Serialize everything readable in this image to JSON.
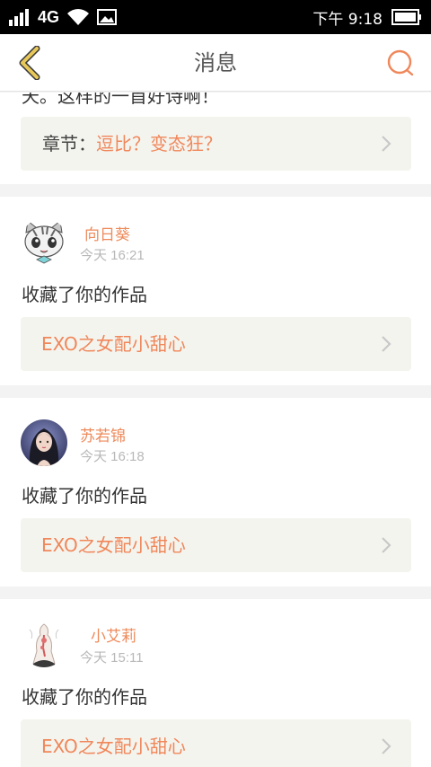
{
  "status_bar": {
    "network": "4G",
    "time": "下午 9:18"
  },
  "nav": {
    "title": "消息",
    "back_icon": "chevron-left-icon",
    "search_icon": "search-icon"
  },
  "partial_item": {
    "text_fragment": "天。这样的一首好诗啊！",
    "chapter_label": "章节：",
    "chapter_title": "逗比？变态狂？"
  },
  "messages": [
    {
      "user": "向日葵",
      "time": "今天 16:21",
      "action": "收藏了你的作品",
      "work": "EXO之女配小甜心"
    },
    {
      "user": "苏若锦",
      "time": "今天 16:18",
      "action": "收藏了你的作品",
      "work": "EXO之女配小甜心"
    },
    {
      "user": "小艾莉",
      "time": "今天 15:11",
      "action": "收藏了你的作品",
      "work": "EXO之女配小甜心"
    }
  ],
  "colors": {
    "accent": "#f0875a",
    "back_icon": "#e8c85a"
  }
}
